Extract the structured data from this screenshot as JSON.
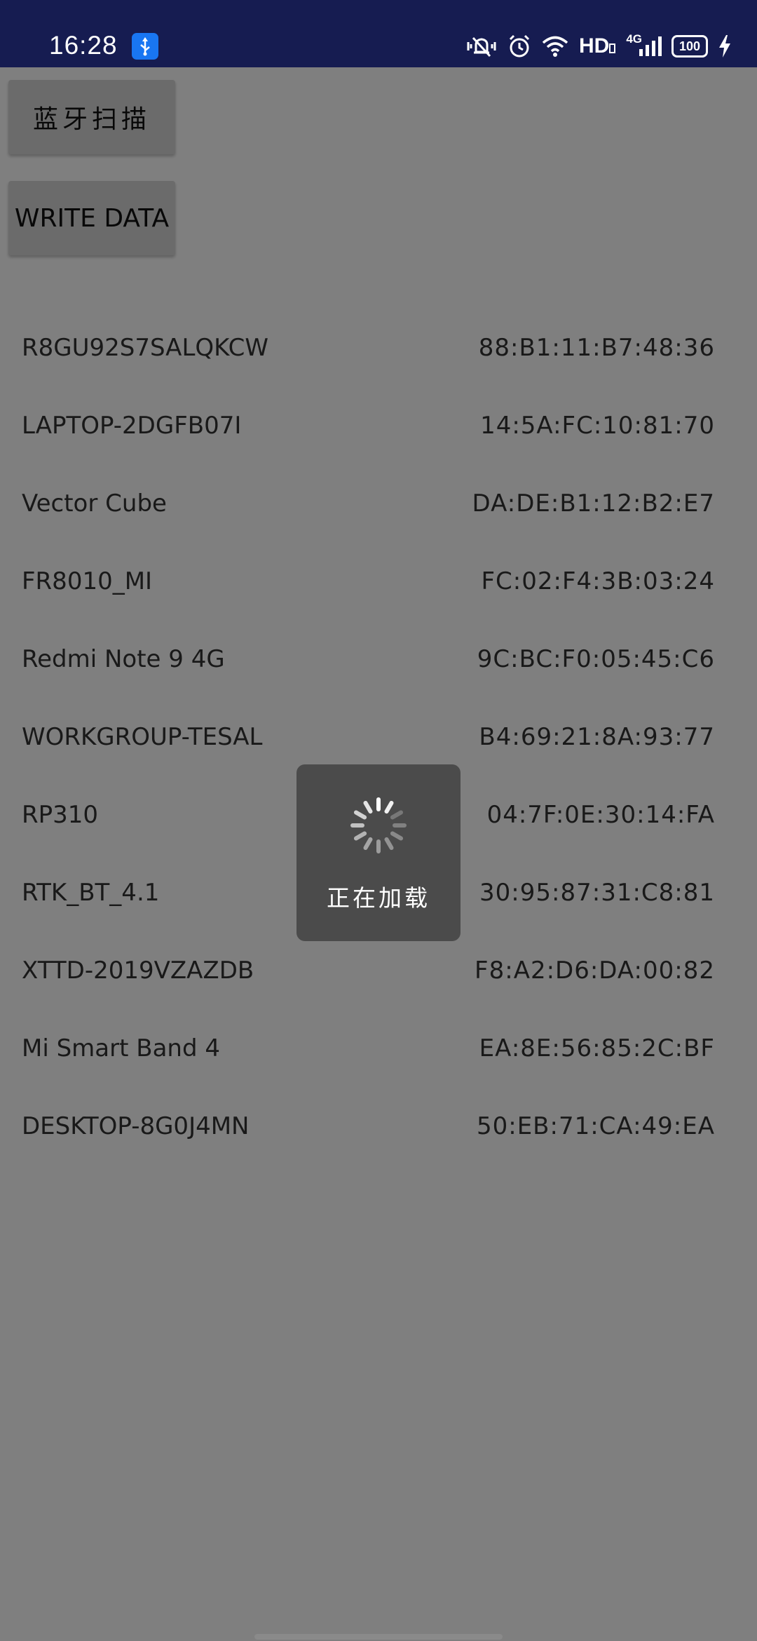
{
  "status_bar": {
    "time": "16:28",
    "hd_label": "HD",
    "network_label": "4G",
    "battery_level": "100",
    "icons": [
      "usb-debug-icon",
      "mute-vibrate-icon",
      "alarm-icon",
      "wifi-icon",
      "hd-icon",
      "cellular-signal-icon",
      "battery-icon",
      "charging-icon"
    ]
  },
  "buttons": {
    "scan_label": "蓝牙扫描",
    "write_label": "WRITE DATA"
  },
  "devices": [
    {
      "name": "R8GU92S7SALQKCW",
      "mac": "88:B1:11:B7:48:36"
    },
    {
      "name": "LAPTOP-2DGFB07I",
      "mac": "14:5A:FC:10:81:70"
    },
    {
      "name": "Vector Cube",
      "mac": "DA:DE:B1:12:B2:E7"
    },
    {
      "name": "FR8010_MI",
      "mac": "FC:02:F4:3B:03:24"
    },
    {
      "name": "Redmi Note 9 4G",
      "mac": "9C:BC:F0:05:45:C6"
    },
    {
      "name": "WORKGROUP-TESAL",
      "mac": "B4:69:21:8A:93:77"
    },
    {
      "name": "RP310",
      "mac": "04:7F:0E:30:14:FA"
    },
    {
      "name": "RTK_BT_4.1",
      "mac": "30:95:87:31:C8:81"
    },
    {
      "name": "XTTD-2019VZAZDB",
      "mac": "F8:A2:D6:DA:00:82"
    },
    {
      "name": "Mi Smart Band 4",
      "mac": "EA:8E:56:85:2C:BF"
    },
    {
      "name": "DESKTOP-8G0J4MN",
      "mac": "50:EB:71:CA:49:EA"
    }
  ],
  "loading": {
    "text": "正在加载",
    "icon": "loading-spinner-icon"
  },
  "colors": {
    "status_bar": "#161c51",
    "usb_badge": "#1976f2",
    "button_bg": "#d6d6d6",
    "dialog_bg": "#4b4b4b"
  }
}
